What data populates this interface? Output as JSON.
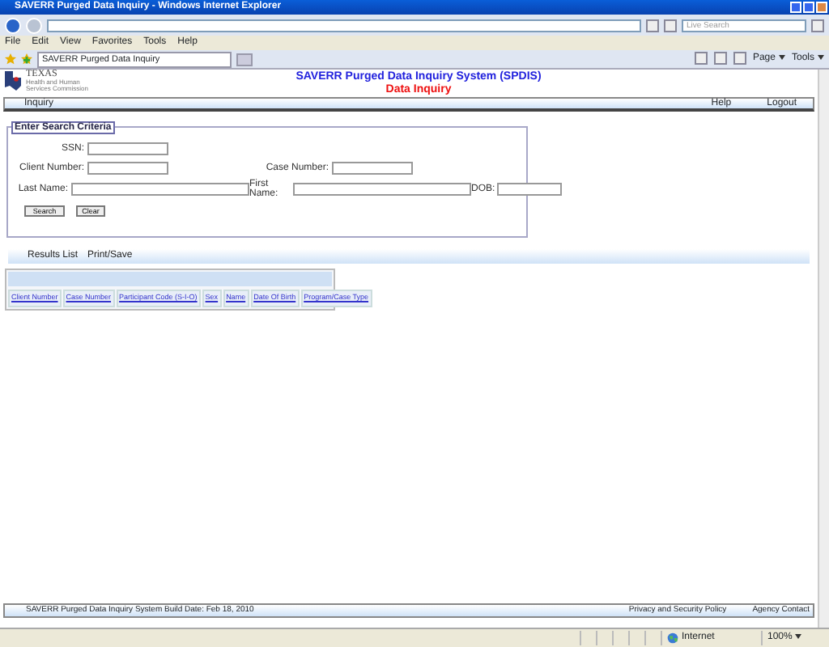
{
  "window": {
    "title": "SAVERR Purged Data Inquiry - Windows Internet Explorer"
  },
  "browser": {
    "search_placeholder": "Live Search",
    "menu": [
      "File",
      "Edit",
      "View",
      "Favorites",
      "Tools",
      "Help"
    ],
    "tab": "SAVERR Purged Data Inquiry",
    "toolbar": [
      "Page",
      "Tools"
    ],
    "zone": "Internet",
    "zoom": "100%"
  },
  "header": {
    "logo_name": "TEXAS",
    "logo_subtitle": "Health and Human Services Commission",
    "title": "SAVERR Purged Data Inquiry System (SPDIS)",
    "subtitle": "Data Inquiry"
  },
  "nav": {
    "left": [
      "Inquiry"
    ],
    "right": [
      "Help",
      "Logout"
    ]
  },
  "search": {
    "legend": "Enter Search Criteria",
    "rows": [
      [
        {
          "label": "SSN:",
          "kind": "short"
        }
      ],
      [
        {
          "label": "Client Number:",
          "kind": "short"
        },
        {
          "label": "Case Number:",
          "kind": "short"
        }
      ],
      [
        {
          "label": "Last Name:",
          "kind": "long"
        },
        {
          "label": "First Name:",
          "kind": "long"
        },
        {
          "label": "DOB:",
          "kind": "date"
        }
      ]
    ],
    "buttons": [
      "Search",
      "Clear"
    ]
  },
  "results": {
    "tabs": [
      "Results List",
      "Print/Save"
    ],
    "columns": [
      "Client Number",
      "Case Number",
      "Participant Code (S-I-O)",
      "Sex",
      "Name",
      "Date Of Birth",
      "Program/Case Type"
    ]
  },
  "footer": {
    "build": "SAVERR Purged Data Inquiry System Build Date: Feb 18, 2010",
    "links": [
      "Privacy and Security Policy",
      "Agency Contact"
    ]
  }
}
